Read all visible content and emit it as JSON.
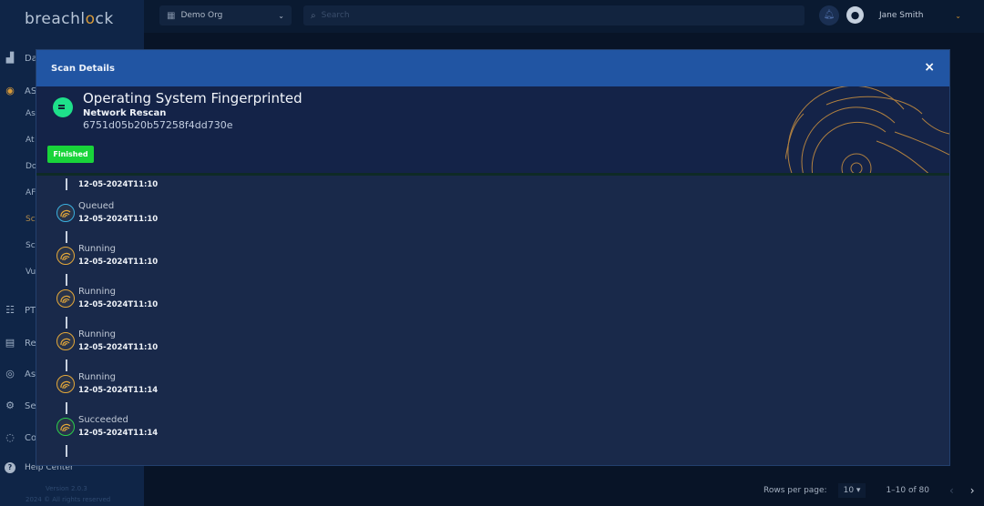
{
  "app": {
    "logo_text_a": "breachl",
    "logo_text_o": "o",
    "logo_text_b": "ck"
  },
  "sidebar": {
    "items": [
      {
        "label": "Da",
        "icon": "chart-icon"
      },
      {
        "label": "AS",
        "icon": "asm-icon"
      },
      {
        "label": "PT",
        "icon": "pt-icon"
      },
      {
        "label": "Re",
        "icon": "report-icon"
      },
      {
        "label": "As",
        "icon": "asset-icon"
      },
      {
        "label": "Se",
        "icon": "settings-icon"
      },
      {
        "label": "Co",
        "icon": "chat-icon"
      }
    ],
    "subitems": [
      "As",
      "At",
      "Do",
      "AF",
      "Sc",
      "Sc",
      "Vu"
    ],
    "help": "Help Center",
    "version": "Version 2.0.3",
    "copyright": "2024 © All rights reserved"
  },
  "topbar": {
    "org": "Demo Org",
    "search_placeholder": "Search",
    "user": "Jane Smith"
  },
  "modal": {
    "title": "Scan Details",
    "close": "×",
    "scan_title": "Operating System Fingerprinted",
    "scan_type": "Network Rescan",
    "scan_id": "6751d05b20b57258f4dd730e",
    "status": "Finished",
    "first_time": "12-05-2024T11:10",
    "timeline": [
      {
        "status": "Queued",
        "time": "12-05-2024T11:10",
        "color": "#3ab0e0"
      },
      {
        "status": "Running",
        "time": "12-05-2024T11:10",
        "color": "#e4a83a"
      },
      {
        "status": "Running",
        "time": "12-05-2024T11:10",
        "color": "#e4a83a"
      },
      {
        "status": "Running",
        "time": "12-05-2024T11:10",
        "color": "#e4a83a"
      },
      {
        "status": "Running",
        "time": "12-05-2024T11:14",
        "color": "#e4a83a"
      },
      {
        "status": "Succeeded",
        "time": "12-05-2024T11:14",
        "color": "#2bcf4a"
      }
    ]
  },
  "pager": {
    "rows_label": "Rows per page:",
    "rows_value": "10",
    "range": "1–10 of 80",
    "prev": "‹",
    "next": "›"
  }
}
